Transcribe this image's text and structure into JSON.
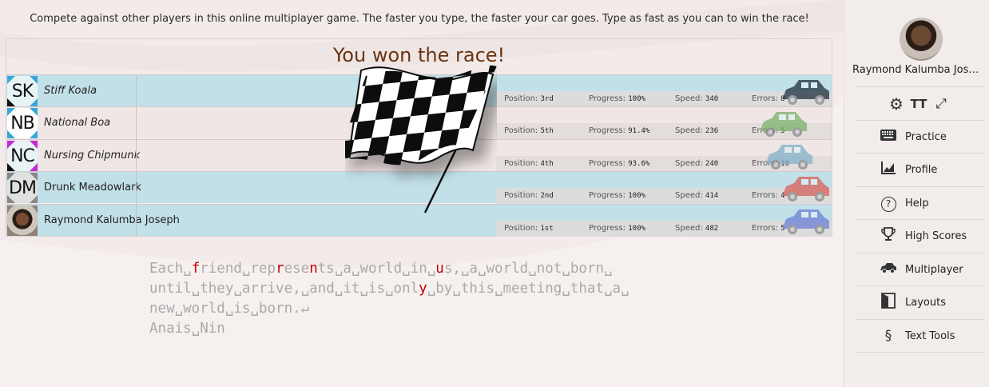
{
  "intro": "Compete against other players in this online multiplayer game. The faster you type, the faster your car goes. Type as fast as you can to win the race!",
  "race": {
    "title": "You won the race!",
    "labels": {
      "position": "Position:",
      "progress": "Progress:",
      "speed": "Speed:",
      "errors": "Errors:"
    },
    "racers": [
      {
        "initials": "SK",
        "name": "Stiff Koala",
        "italic": true,
        "position": "3rd",
        "progress": "100%",
        "progress_fraction": 1.0,
        "speed": "340",
        "errors": "8",
        "row_color": "blue",
        "car_color": "#1f2f3f"
      },
      {
        "initials": "NB",
        "name": "National Boa",
        "italic": true,
        "position": "5th",
        "progress": "91.4%",
        "progress_fraction": 0.914,
        "speed": "236",
        "errors": "5",
        "row_color": "pink",
        "car_color": "#7ab36a"
      },
      {
        "initials": "NC",
        "name": "Nursing Chipmunk",
        "italic": true,
        "position": "4th",
        "progress": "93.6%",
        "progress_fraction": 0.936,
        "speed": "240",
        "errors": "10",
        "row_color": "pink",
        "car_color": "#7fb0c8"
      },
      {
        "initials": "DM",
        "name": "Drunk Meadowlark",
        "italic": false,
        "position": "2nd",
        "progress": "100%",
        "progress_fraction": 1.0,
        "speed": "414",
        "errors": "4",
        "row_color": "blue",
        "car_color": "#d6605a"
      },
      {
        "initials": "",
        "name": "Raymond Kalumba Joseph",
        "italic": false,
        "position": "1st",
        "progress": "100%",
        "progress_fraction": 1.0,
        "speed": "482",
        "errors": "5",
        "row_color": "blue",
        "car_color": "#6b7fd6"
      }
    ]
  },
  "text_lines": [
    [
      {
        "t": "Each␣"
      },
      {
        "t": "f",
        "err": true
      },
      {
        "t": "riend␣rep"
      },
      {
        "t": "r",
        "err": true
      },
      {
        "t": "ese"
      },
      {
        "t": "n",
        "err": true
      },
      {
        "t": "ts␣a␣world␣in␣"
      },
      {
        "t": "u",
        "err": true
      },
      {
        "t": "s,␣a␣world␣not␣born␣"
      }
    ],
    [
      {
        "t": "until␣they␣arrive,␣and␣it␣is␣onl"
      },
      {
        "t": "y",
        "err": true
      },
      {
        "t": "␣by␣this␣meeting␣that␣a␣"
      }
    ],
    [
      {
        "t": "new␣world␣is␣born.↵"
      }
    ],
    [
      {
        "t": "Anais␣Nin"
      }
    ]
  ],
  "sidebar": {
    "user_name": "Raymond Kalumba Jose…",
    "tools": [
      "gear-icon",
      "text-size-icon",
      "fullscreen-icon"
    ],
    "menu": [
      {
        "label": "Practice",
        "icon": "keyboard-icon"
      },
      {
        "label": "Profile",
        "icon": "chart-icon"
      },
      {
        "label": "Help",
        "icon": "help-icon"
      },
      {
        "label": "High Scores",
        "icon": "trophy-icon"
      },
      {
        "label": "Multiplayer",
        "icon": "car-icon"
      },
      {
        "label": "Layouts",
        "icon": "layouts-icon"
      },
      {
        "label": "Text Tools",
        "icon": "section-icon"
      }
    ]
  },
  "colors": {
    "accent": "#6b3410",
    "error": "#c00000",
    "row_blue": "#c2e0e8",
    "row_pink": "#efe6e5"
  }
}
